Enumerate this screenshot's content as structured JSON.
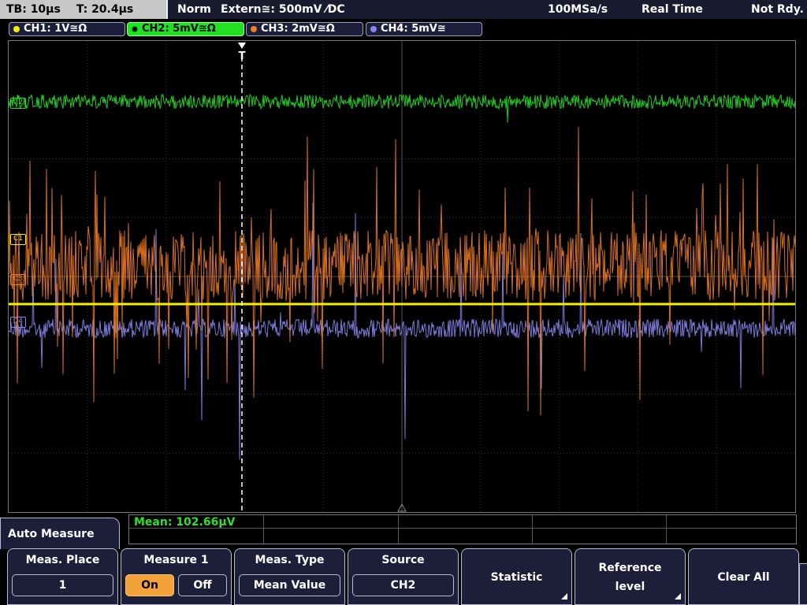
{
  "topbar": {
    "timebase": "TB: 10µs",
    "trigger_time": "T: 20.4µs",
    "mode": "Norm",
    "trigger_source": "Extern≅: 500mV ⁄DC",
    "sample_rate": "100MSa/s",
    "acq_mode": "Real Time",
    "status": "Not Rdy."
  },
  "channels": [
    {
      "label": "CH1: 1V≅Ω",
      "color": "#f5f000"
    },
    {
      "label": "CH2: 5mV≅Ω",
      "color": "#22e022"
    },
    {
      "label": "CH3: 2mV≅Ω",
      "color": "#f07b22"
    },
    {
      "label": "CH4: 5mV≅",
      "color": "#8a86ee"
    }
  ],
  "markers": {
    "c1": "C1",
    "c2": "C2",
    "c3": "C3",
    "c4": "C4",
    "trigger": "T"
  },
  "measurement": {
    "readout": "Mean: 102.66µV"
  },
  "menu": {
    "title": "Auto Measure",
    "softkeys": {
      "meas_place": {
        "title": "Meas. Place",
        "value": "1"
      },
      "measure1": {
        "title": "Measure 1",
        "on": "On",
        "off": "Off"
      },
      "meas_type": {
        "title": "Meas. Type",
        "value": "Mean Value"
      },
      "source": {
        "title": "Source",
        "value": "CH2"
      },
      "statistic": {
        "label": "Statistic"
      },
      "reference": {
        "line1": "Reference",
        "line2": "level"
      },
      "clear_all": {
        "label": "Clear All"
      }
    }
  }
}
